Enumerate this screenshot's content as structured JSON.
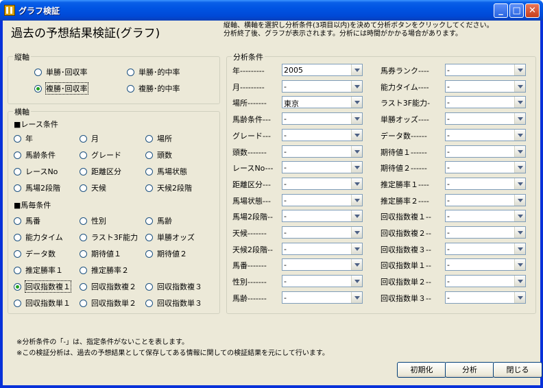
{
  "window": {
    "title": "グラフ検証"
  },
  "header": {
    "title": "過去の予想結果検証(グラフ)",
    "instructions": "縦軸、横軸を選択し分析条件(3項目以内)を決めて分析ボタンをクリックしてください。\n分析終了後、グラフが表示されます。分析には時間がかかる場合があります。"
  },
  "vertical_axis": {
    "legend": "縦軸",
    "options": [
      {
        "label": "単勝･回収率",
        "selected": false
      },
      {
        "label": "単勝･的中率",
        "selected": false
      },
      {
        "label": "複勝･回収率",
        "selected": true
      },
      {
        "label": "複勝･的中率",
        "selected": false
      }
    ]
  },
  "horizontal_axis": {
    "legend": "横軸",
    "race_section": "■レース条件",
    "race_options": [
      "年",
      "月",
      "場所",
      "馬齢条件",
      "グレード",
      "頭数",
      "レースNo",
      "距離区分",
      "馬場状態",
      "馬場2段階",
      "天候",
      "天候2段階"
    ],
    "horse_section": "■馬毎条件",
    "horse_options": [
      "馬番",
      "性別",
      "馬齢",
      "能力タイム",
      "ラスト3F能力",
      "単勝オッズ",
      "データ数",
      "期待値１",
      "期待値２",
      "推定勝率１",
      "推定勝率２",
      "",
      "回収指数複１",
      "回収指数複２",
      "回収指数複３",
      "回収指数単１",
      "回収指数単２",
      "回収指数単３"
    ],
    "selected": "回収指数複１"
  },
  "conditions": {
    "legend": "分析条件",
    "left": [
      {
        "label": "年---------",
        "value": "2005"
      },
      {
        "label": "月---------",
        "value": "-"
      },
      {
        "label": "場所-------",
        "value": "東京"
      },
      {
        "label": "馬齢条件---",
        "value": "-"
      },
      {
        "label": "グレード---",
        "value": "-"
      },
      {
        "label": "頭数-------",
        "value": "-"
      },
      {
        "label": "レースNo---",
        "value": "-"
      },
      {
        "label": "距離区分---",
        "value": "-"
      },
      {
        "label": "馬場状態---",
        "value": "-"
      },
      {
        "label": "馬場2段階--",
        "value": "-"
      },
      {
        "label": "天候-------",
        "value": "-"
      },
      {
        "label": "天候2段階--",
        "value": "-"
      },
      {
        "label": "馬番-------",
        "value": "-"
      },
      {
        "label": "性別-------",
        "value": "-"
      },
      {
        "label": "馬齢-------",
        "value": "-"
      }
    ],
    "right": [
      {
        "label": "馬券ランク----",
        "value": "-"
      },
      {
        "label": "能力タイム----",
        "value": "-"
      },
      {
        "label": "ラスト3F能力-",
        "value": "-"
      },
      {
        "label": "単勝オッズ----",
        "value": "-"
      },
      {
        "label": "データ数------",
        "value": "-"
      },
      {
        "label": "期待値１------",
        "value": "-"
      },
      {
        "label": "期待値２------",
        "value": "-"
      },
      {
        "label": "推定勝率１----",
        "value": "-"
      },
      {
        "label": "推定勝率２----",
        "value": "-"
      },
      {
        "label": "回収指数複１--",
        "value": "-"
      },
      {
        "label": "回収指数複２--",
        "value": "-"
      },
      {
        "label": "回収指数複３--",
        "value": "-"
      },
      {
        "label": "回収指数単１--",
        "value": "-"
      },
      {
        "label": "回収指数単２--",
        "value": "-"
      },
      {
        "label": "回収指数単３--",
        "value": "-"
      }
    ]
  },
  "notes": "※分析条件の「-」は、指定条件がないことを表します。\n※この検証分析は、過去の予想結果として保存してある情報に関しての検証結果を元にして行います。",
  "buttons": {
    "reset": "初期化",
    "analyze": "分析",
    "close": "閉じる"
  },
  "colors": {
    "titlebar": "#0054e3",
    "client_bg": "#ece9d8",
    "radio_dot": "#21a121",
    "field_border": "#7f9db9"
  }
}
